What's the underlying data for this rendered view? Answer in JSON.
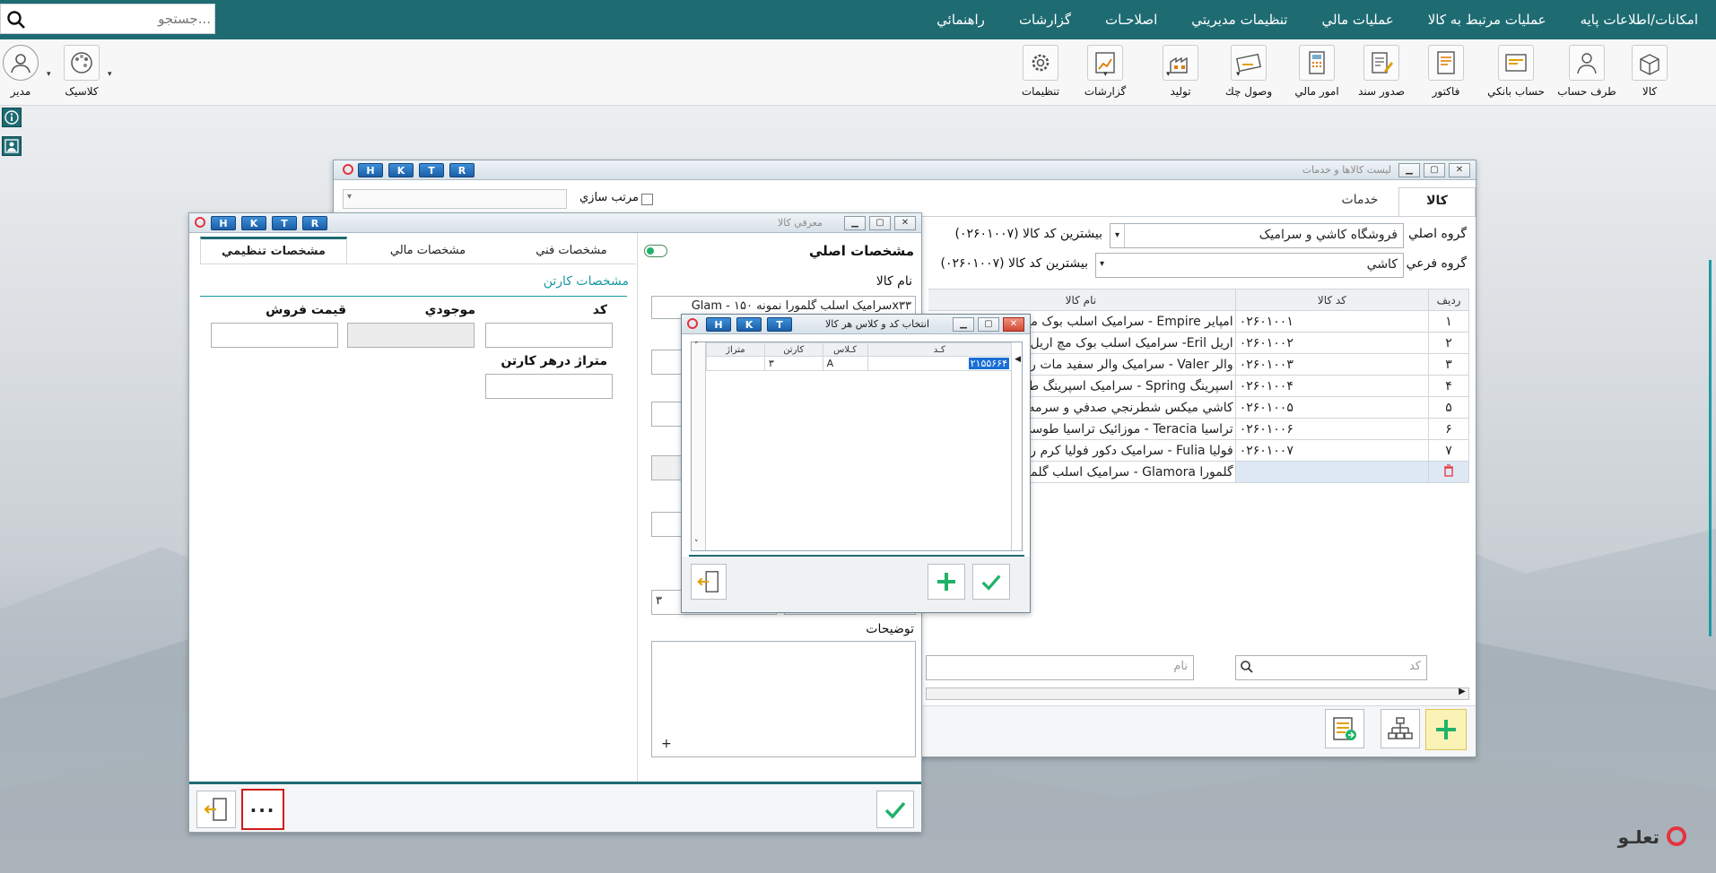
{
  "menubar": {
    "items": [
      "امکانات/اطلاعات پايه",
      "عمليات مرتبط به کالا",
      "عمليات مالي",
      "تنظيمات مديريتي",
      "اصلاحـات",
      "گزارشات",
      "راهنمائي"
    ],
    "search_placeholder": "جستجو..."
  },
  "toolbar": {
    "buttons": [
      {
        "label": "کالا",
        "icon": "box-icon"
      },
      {
        "label": "طرف حساب",
        "icon": "person-icon"
      },
      {
        "label": "حساب بانکي",
        "icon": "bank-account-icon"
      },
      {
        "label": "فاکتور",
        "icon": "invoice-icon"
      },
      {
        "label": "صدور سند",
        "icon": "document-pen-icon"
      },
      {
        "label": "امور مالي",
        "icon": "calculator-icon"
      },
      {
        "label": "وصول چك",
        "icon": "cheque-icon"
      },
      {
        "label": "توليد",
        "icon": "factory-icon"
      },
      {
        "label": "گزارشات",
        "icon": "chart-report-icon"
      },
      {
        "label": "تنظيمات",
        "icon": "gear-icon"
      }
    ],
    "left_buttons": [
      {
        "label": "کلاسيک",
        "icon": "palette-icon"
      },
      {
        "label": "مدير",
        "icon": "user-icon"
      }
    ]
  },
  "list_window": {
    "title": "ليست کالاها و خدمات",
    "hktr": [
      "H",
      "K",
      "T",
      "R"
    ],
    "sort_label": "مرتب سازي",
    "tabs": [
      "کالا",
      "خدمات"
    ],
    "main_group_label": "گروه اصلي",
    "main_group_value": "فروشگاه کاشي و سراميک",
    "sub_group_label": "گروه فرعي",
    "sub_group_value": "کاشي",
    "max_code_label_1": "بيشترين کد کالا (۰۲۶۰۱۰۰۷)",
    "max_code_label_2": "بيشترين کد کالا (۰۲۶۰۱۰۰۷)",
    "columns": {
      "row": "رديف",
      "code": "کد کالا",
      "name": "نام کالا"
    },
    "rows": [
      {
        "row": "۱",
        "code": "۰۲۶۰۱۰۰۱",
        "name": "امپاير Empire - سراميک اسلب بوک مچ"
      },
      {
        "row": "۲",
        "code": "۰۲۶۰۱۰۰۲",
        "name": "اريل Eril- سراميک اسلب بوک مچ اريل"
      },
      {
        "row": "۳",
        "code": "۰۲۶۰۱۰۰۳",
        "name": "والر Valer - سراميک والر سفيد مات رگه"
      },
      {
        "row": "۴",
        "code": "۰۲۶۰۱۰۰۴",
        "name": "اسپرينگ Spring - سراميک اسپرينگ طوسي"
      },
      {
        "row": "۵",
        "code": "۰۲۶۰۱۰۰۵",
        "name": "کاشي ميکس شطرنجي صدفي و سرمه اي"
      },
      {
        "row": "۶",
        "code": "۰۲۶۰۱۰۰۶",
        "name": "تراسيا Teracia - موزائيک تراسيا طوسي"
      },
      {
        "row": "۷",
        "code": "۰۲۶۰۱۰۰۷",
        "name": "فوليا Fulia - سراميک دکور فوليا کرم رگه"
      },
      {
        "row": "",
        "code": "",
        "name": "گلمورا Glamora - سراميک اسلب گلمورا"
      }
    ],
    "code_search_placeholder": "کد",
    "name_search_placeholder": "نام"
  },
  "item_window": {
    "title": "معرفي کالا",
    "hktr": [
      "H",
      "K",
      "T",
      "R"
    ],
    "main_specs_label": "مشخصات اصلي",
    "tabs": [
      "مشخصات فني",
      "مشخصات مالي",
      "مشخصات تنظيمي"
    ],
    "item_name_label": "نام کالا",
    "item_name_value": "Glam - سراميک اسلب گلمورا نمونه ۱۵۰x۳۳",
    "description_label": "توضيحات",
    "qty_value": "۳",
    "carton_section": "مشخصات کارتن",
    "code_label": "کد",
    "stock_label": "موجودي",
    "price_label": "قيمت فروش",
    "meter_label": "متراژ درهر کارتن",
    "more_button": "..."
  },
  "code_class_dialog": {
    "title": "انتخاب کد و کلاس هر کالا",
    "hktr": [
      "H",
      "K",
      "T"
    ],
    "columns": [
      "کـد",
      "کـلاس",
      "کارتن",
      "متراژ"
    ],
    "row": {
      "code": "۲۱۵۵۶۶۴",
      "class": "A",
      "carton": "۳",
      "meter": ""
    }
  },
  "brand": "تعلـو",
  "colors": {
    "menubar": "#1e6b72",
    "accent": "#1b9aa2",
    "add_green": "#21b26a"
  }
}
